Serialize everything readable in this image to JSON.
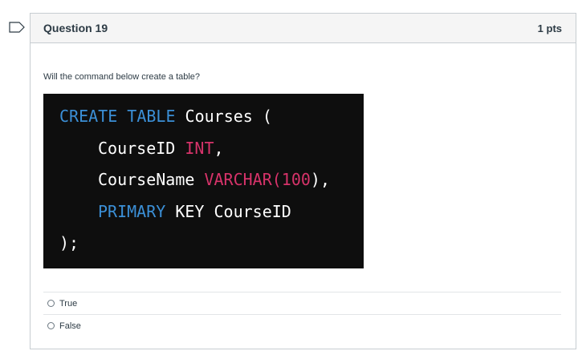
{
  "question": {
    "title": "Question 19",
    "points": "1 pts",
    "prompt": "Will the command below create a table?",
    "flag_icon": "flag-icon"
  },
  "code": {
    "line1": {
      "kw1": "CREATE TABLE",
      "rest": " Courses ("
    },
    "line2": {
      "name": "CourseID",
      "type": "INT",
      "end": ","
    },
    "line3": {
      "name": "CourseName",
      "type": "VARCHAR(",
      "num": "100",
      "end": "),"
    },
    "line4": {
      "kw": "PRIMARY",
      "rest": " KEY CourseID"
    },
    "line5": {
      "text": ");"
    }
  },
  "answers": [
    {
      "label": "True"
    },
    {
      "label": "False"
    }
  ],
  "colors": {
    "keyword": "#3b8fd6",
    "type": "#d7336a",
    "code_bg": "#0e0e0e"
  }
}
